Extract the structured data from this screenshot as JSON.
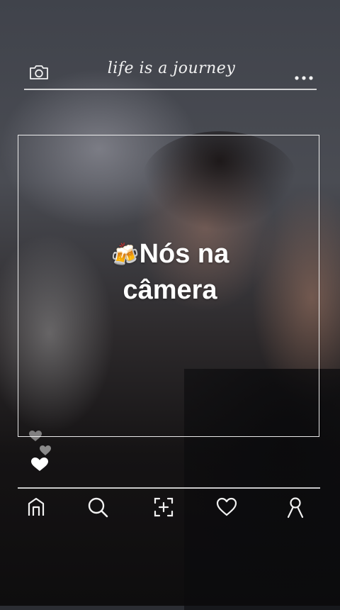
{
  "header": {
    "title": "life is a journey",
    "left_icon": "camera-icon",
    "right_icon": "more-dots-icon"
  },
  "post": {
    "caption_line1": "Nós na",
    "caption_line2": "câmera",
    "caption_emoji": "🍻",
    "reaction_icon": "heart-icon"
  },
  "nav": {
    "items": [
      {
        "icon": "home-icon"
      },
      {
        "icon": "search-icon"
      },
      {
        "icon": "add-icon"
      },
      {
        "icon": "heart-icon"
      },
      {
        "icon": "profile-icon"
      }
    ]
  },
  "colors": {
    "ui_lines": "#f0f0f0",
    "text": "#ffffff"
  }
}
